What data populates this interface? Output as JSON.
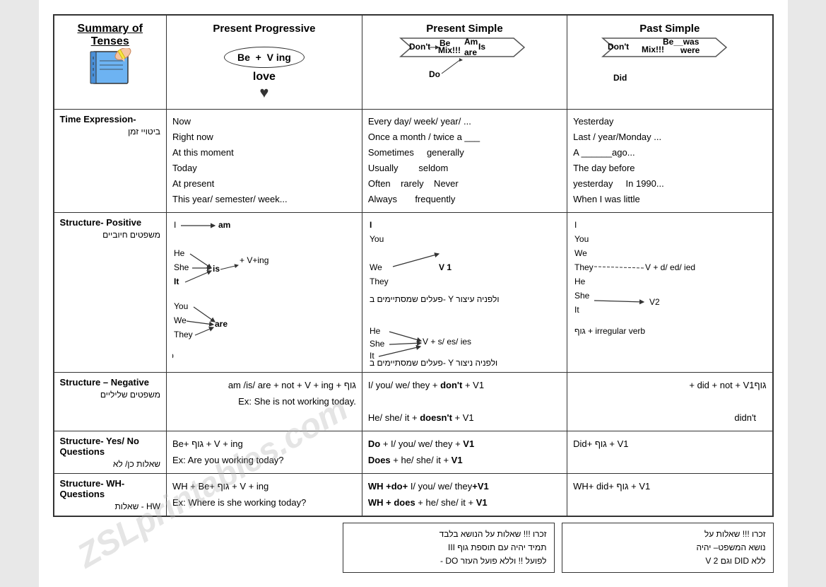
{
  "title": "Summary of Tenses",
  "headers": {
    "col1": "Summary of Tenses",
    "col2": "Present Progressive",
    "col3": "Present Simple",
    "col4": "Past Simple"
  },
  "rows": {
    "time_expression": {
      "label": "Time Expression-",
      "label_hebrew": "ביטויי זמן",
      "pp": "Now\nRight now\nAt this moment\nToday\nAt present\nThis year/ semester/ week...",
      "ps": "Every day/ week/ year/ ...\nOnce a month / twice a ___\nSometimes    generally\nUsually        seldom\nOften    rarely    Never\nAlways        frequently",
      "past": "Yesterday\nLast / year/Monday ...\nA ______ago...\nThe day before\nyesterday    In 1990...\nWhen I was little"
    },
    "struct_positive": {
      "label": "Structure- Positive",
      "label_hebrew": "משפטים חיוביים"
    },
    "struct_negative": {
      "label": "Structure – Negative",
      "label_hebrew": "משפטים שליליים",
      "pp": "גוף + am /is/ are + not + V + ing\nEx: She is not working today.",
      "ps": "I/ you/ we/ they + don't + V1\nHe/ she/ it + doesn't + V1",
      "past": "גוף + did + not + V1\ndidn't"
    },
    "struct_yn": {
      "label": "Structure- Yes/ No Questions",
      "label_hebrew": "שאלות כן/ לא",
      "pp": "Be+ גוף + V + ing\nEx: Are you working today?",
      "ps_bold": "Do + I/ you/ we/ they + V1\nDoes + he/ she/ it + V1",
      "past": "Did+ גוף + V1"
    },
    "struct_wh": {
      "label": "Structure- WH- Questions",
      "label_hebrew": "WH - שאלות",
      "pp": "WH + Be+ גוף + V + ing\nEx: Where is she working today?",
      "ps_bold": "WH +do+ I/ you/ we/ they+V1\nWH + does + he/ she/ it + V1",
      "past": "WH+ did+ גוף + V1"
    }
  },
  "bottom_note1": {
    "line1": "זכרו !!! שאלות על הנושא בלבד",
    "line2": "תמיד יהיה עם תוספת גוף III",
    "line3": "לפועל !! וללא פועל העזר DO -"
  },
  "bottom_note2": {
    "line1": "זכרו !!! שאלות על",
    "line2": "נושא המשפט– יהיה",
    "line3": "ללא DID וגם V 2"
  },
  "watermark": "ZSLprintables.com"
}
